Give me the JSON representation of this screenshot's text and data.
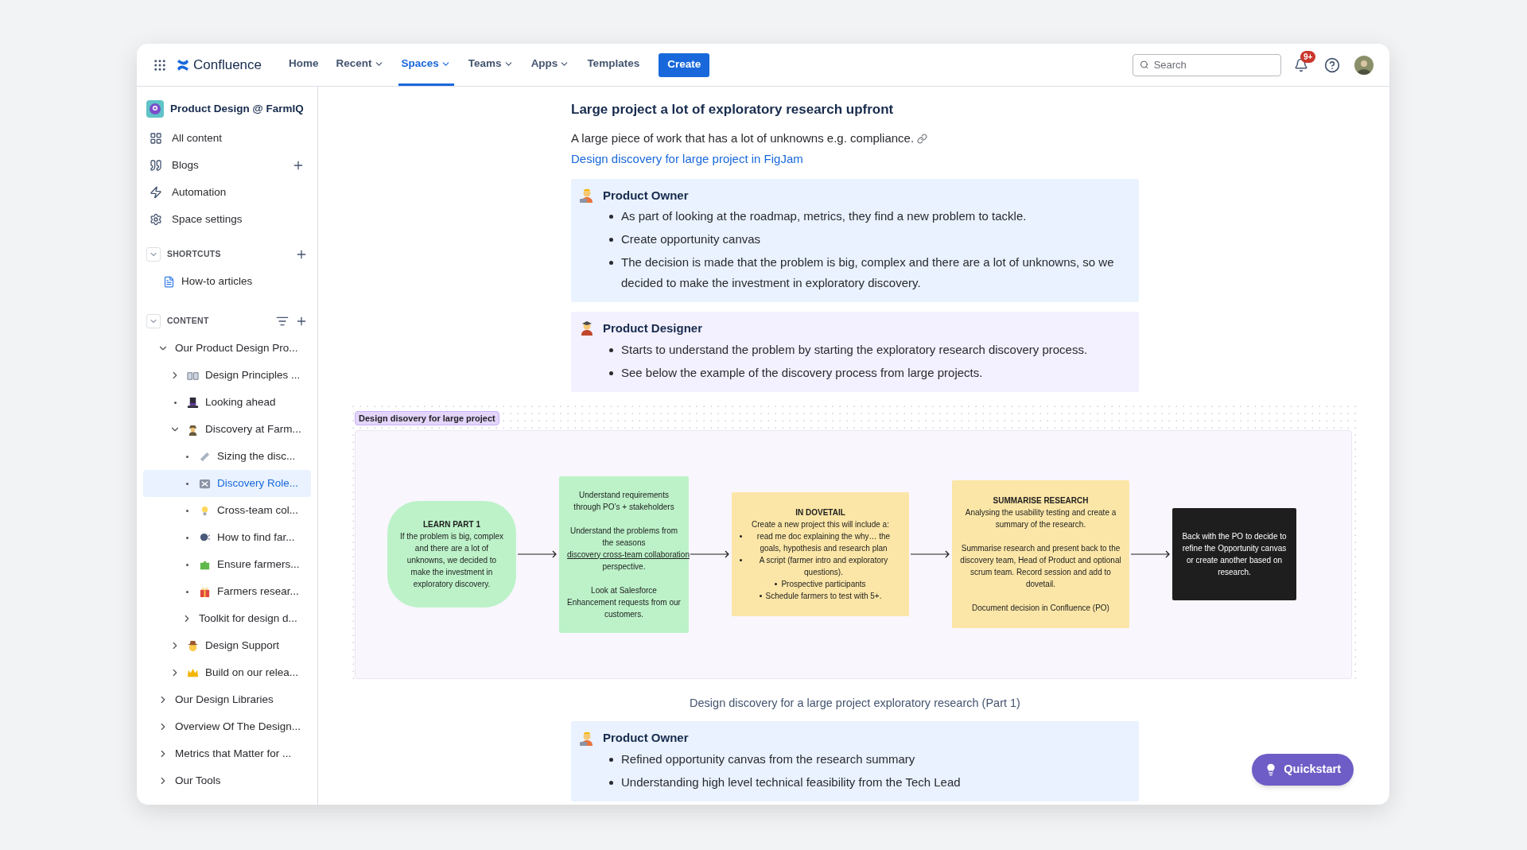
{
  "nav": {
    "product": "Confluence",
    "items": [
      {
        "label": "Home",
        "dropdown": false,
        "selected": false
      },
      {
        "label": "Recent",
        "dropdown": true,
        "selected": false
      },
      {
        "label": "Spaces",
        "dropdown": true,
        "selected": true
      },
      {
        "label": "Teams",
        "dropdown": true,
        "selected": false
      },
      {
        "label": "Apps",
        "dropdown": true,
        "selected": false
      },
      {
        "label": "Templates",
        "dropdown": false,
        "selected": false
      }
    ],
    "create": "Create",
    "search": {
      "placeholder": "Search"
    },
    "notifications_badge": "9+"
  },
  "sidebar": {
    "space": "Product Design @ FarmIQ",
    "links": [
      {
        "label": "All content",
        "add": false
      },
      {
        "label": "Blogs",
        "add": true
      },
      {
        "label": "Automation",
        "add": false
      },
      {
        "label": "Space settings",
        "add": false
      }
    ],
    "shortcuts": {
      "title": "SHORTCUTS",
      "expanded": true,
      "items": [
        {
          "label": "How-to articles"
        }
      ]
    },
    "content": {
      "title": "CONTENT",
      "expanded": true,
      "tree": [
        {
          "label": "Our Product Design Pro...",
          "kind": "folder",
          "expanded": true,
          "selected": false,
          "children": [
            {
              "label": "Design Principles ...",
              "kind": "folder",
              "expanded": false,
              "selected": false
            },
            {
              "label": "Looking ahead",
              "kind": "page",
              "selected": false
            },
            {
              "label": "Discovery at Farm...",
              "kind": "folder",
              "expanded": true,
              "selected": false,
              "children": [
                {
                  "label": "Sizing the disc...",
                  "kind": "page",
                  "selected": false
                },
                {
                  "label": "Discovery Role...",
                  "kind": "page",
                  "selected": true
                },
                {
                  "label": "Cross-team col...",
                  "kind": "page",
                  "selected": false
                },
                {
                  "label": "How to find far...",
                  "kind": "page",
                  "selected": false
                },
                {
                  "label": "Ensure farmers...",
                  "kind": "page",
                  "selected": false
                },
                {
                  "label": "Farmers resear...",
                  "kind": "page",
                  "selected": false
                },
                {
                  "label": "Toolkit for design d...",
                  "kind": "folder",
                  "expanded": false,
                  "selected": false
                }
              ]
            },
            {
              "label": "Design Support",
              "kind": "folder",
              "expanded": false,
              "selected": false
            },
            {
              "label": "Build on our relea...",
              "kind": "folder",
              "expanded": false,
              "selected": false
            }
          ]
        },
        {
          "label": "Our Design Libraries",
          "kind": "folder",
          "expanded": false,
          "selected": false
        },
        {
          "label": "Overview Of The Design...",
          "kind": "folder",
          "expanded": false,
          "selected": false
        },
        {
          "label": "Metrics that Matter for ...",
          "kind": "folder",
          "expanded": false,
          "selected": false
        },
        {
          "label": "Our Tools",
          "kind": "folder",
          "expanded": false,
          "selected": false
        }
      ]
    }
  },
  "page": {
    "heading": "Large project a lot of exploratory research upfront",
    "intro": {
      "text": "A large piece of work that has a lot of unknowns e.g. compliance.",
      "link": "Design discovery for large project in FigJam"
    },
    "callouts": [
      {
        "kind": "owner",
        "title": "Product Owner",
        "items": [
          "As part of looking at the roadmap, metrics, they find a new problem to tackle.",
          "Create opportunity canvas",
          "The decision is made that the problem is big, complex and there are a lot of unknowns, so we decided to make the investment in exploratory discovery."
        ]
      },
      {
        "kind": "designer",
        "title": "Product Designer",
        "items": [
          "Starts to understand the problem by starting the exploratory research discovery process.",
          "See below the example of the discovery process from large projects."
        ]
      }
    ],
    "diagram": {
      "tag": "Design disovery for large project",
      "nodes": [
        {
          "kind": "pill",
          "title": "LEARN PART 1",
          "blocks": [
            {
              "kind": "text",
              "text": "If the problem is big, complex and there are a lot of unknowns, we decided to make the investment in exploratory discovery."
            }
          ]
        },
        {
          "kind": "green",
          "blocks": [
            {
              "kind": "text",
              "text": "Understand requirements through PO’s + stakeholders"
            },
            {
              "kind": "link",
              "before": "Understand the problems from the seasons",
              "link": "discovery cross-team collaboration",
              "after": "perspective."
            },
            {
              "kind": "text",
              "text": "Look at Salesforce Enhancement requests from our customers."
            }
          ]
        },
        {
          "kind": "yellow",
          "title": "IN DOVETAIL",
          "blocks": [
            {
              "kind": "tight",
              "text": "Create a new project this will include a:"
            },
            {
              "kind": "bullets",
              "items": [
                "read me doc explaining the why… the goals, hypothesis and research plan",
                "A script (farmer intro and exploratory questions).",
                "Prospective participants",
                "Schedule farmers to test with 5+."
              ]
            }
          ]
        },
        {
          "kind": "yellow",
          "title": "SUMMARISE RESEARCH",
          "blocks": [
            {
              "kind": "tight",
              "text": "Analysing the usability testing and create a summary of the research."
            },
            {
              "kind": "text",
              "text": "Summarise research and present back to the discovery team, Head of Product and optional scrum team. Record session and add to dovetail."
            },
            {
              "kind": "text",
              "text": "Document decision in Confluence (PO)"
            }
          ]
        },
        {
          "kind": "dark",
          "blocks": [
            {
              "kind": "text",
              "text": "Back with the PO to decide to refine the Opportunity canvas or create another based on research."
            }
          ]
        }
      ]
    },
    "caption": "Design discovery for a large project exploratory research (Part 1)",
    "callouts_after": [
      {
        "kind": "owner",
        "title": "Product Owner",
        "items": [
          "Refined opportunity canvas from the research summary",
          "Understanding high level technical feasibility from the Tech Lead"
        ]
      }
    ]
  },
  "quickstart": "Quickstart"
}
